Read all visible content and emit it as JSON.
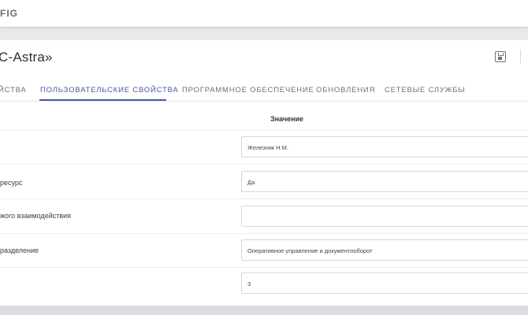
{
  "app": {
    "logo_text": "FIG"
  },
  "header": {
    "title": "C-Astra»",
    "save_icon": "save-icon"
  },
  "tabs": [
    {
      "label": "ЙСТВА",
      "active": false
    },
    {
      "label": "ПОЛЬЗОВАТЕЛЬСКИЕ СВОЙСТВА",
      "active": true
    },
    {
      "label": "ПРОГРАММНОЕ ОБЕСПЕЧЕНИЕ",
      "active": false
    },
    {
      "label": "ОБНОВЛЕНИЯ",
      "active": false
    },
    {
      "label": "СЕТЕВЫЕ СЛУЖБЫ",
      "active": false
    }
  ],
  "table": {
    "value_header": "Значение",
    "rows": [
      {
        "label": "",
        "value": "Железняк Н.М."
      },
      {
        "label": "ресурс",
        "value": "Да"
      },
      {
        "label": "жого взаимодействия",
        "value": ""
      },
      {
        "label": "разделение",
        "value": "Оперативное управление и документооборот"
      },
      {
        "label": "",
        "value": "3"
      }
    ]
  },
  "colors": {
    "accent": "#3f5ba9",
    "background": "#e8e9eb"
  }
}
